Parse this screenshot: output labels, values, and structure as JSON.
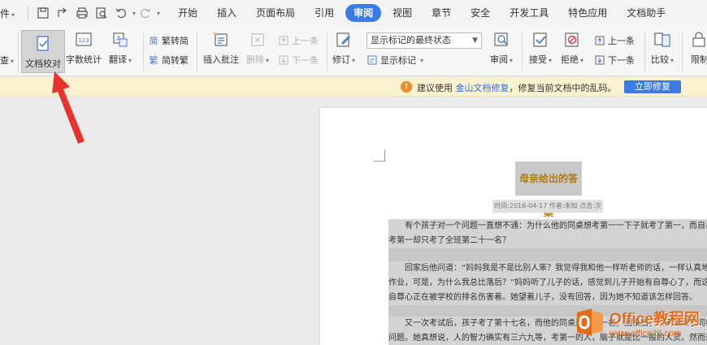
{
  "menubar": {
    "file_label": "件",
    "file_caret": "▾",
    "tabs": [
      {
        "label": "开始",
        "active": false
      },
      {
        "label": "插入",
        "active": false
      },
      {
        "label": "页面布局",
        "active": false
      },
      {
        "label": "引用",
        "active": false
      },
      {
        "label": "审阅",
        "active": true
      },
      {
        "label": "视图",
        "active": false
      },
      {
        "label": "章节",
        "active": false
      },
      {
        "label": "安全",
        "active": false
      },
      {
        "label": "开发工具",
        "active": false
      },
      {
        "label": "特色应用",
        "active": false
      },
      {
        "label": "文档助手",
        "active": false
      }
    ]
  },
  "ribbon": {
    "check": "查",
    "doc_proof": "文档校对",
    "word_count": "字数统计",
    "translate": "翻译",
    "trad": "繁转简",
    "simp": "简转繁",
    "insert_comment": "插入批注",
    "delete": "删除",
    "prev": "上一条",
    "next": "下一条",
    "revise": "修订",
    "markup_state": "显示标记的最终状态",
    "show_markup": "显示标记",
    "review": "审阅",
    "accept": "接受",
    "reject": "拒绝",
    "prev2": "上一条",
    "next2": "下一条",
    "compare": "比较",
    "restrict": "限制"
  },
  "notice": {
    "icon": "!",
    "text_before": "建议使用",
    "link": "金山文档修复",
    "text_after": "，修复当前文档中的乱码。",
    "button": "立即修复"
  },
  "document": {
    "title": "母亲给出的答案",
    "meta": "时间:2016-04-17  作者:未知  点击:次",
    "paragraphs": [
      [
        "有个孩子对一个问题一直想不通：为什么他的同桌想考第一一下子就考了第一，而自己想",
        "考第一却只考了全班第二十一名？"
      ],
      [
        "回家后他问道：“妈妈我是不是比别人笨？我觉得我和他一样听老师的话，一样认真地做",
        "作业，可是，为什么我总比落后？”妈妈听了儿子的话，感觉到儿子开始有自尊心了，而这种",
        "自尊心正在被学校的排名伤害着。她望着儿子，没有回答，因为她不知道该怎样回答。"
      ],
      [
        "又一次考试后，孩子考了第十七名，而他的同桌还是第一名。回家后，儿子又问了同样的",
        "问题。她真想说，人的智力确实有三六九等，考第一的人，脑子就是比一般的人灵。然而这样"
      ]
    ]
  },
  "watermark": {
    "main": "Office教程网",
    "url": "www.office26.com"
  },
  "colors": {
    "accent": "#3c7be5",
    "arrow": "#e8322e",
    "watermark": "#e46a1c",
    "notice_bg": "#fbf2cf"
  }
}
